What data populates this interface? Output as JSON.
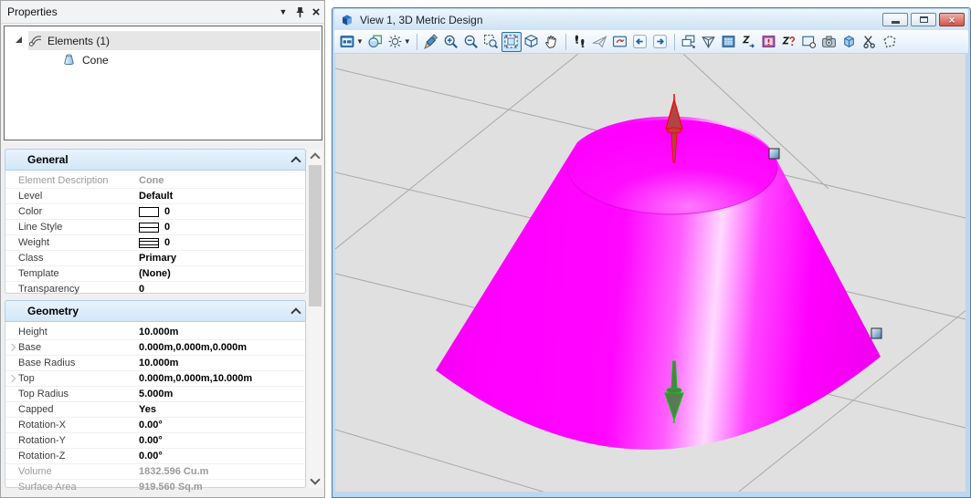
{
  "properties_panel": {
    "title": "Properties",
    "titlebar_icons": [
      "panel-menu-arrow-icon",
      "pin-icon",
      "close-icon"
    ],
    "tree": {
      "root_label": "Elements (1)",
      "items": [
        {
          "label": "Cone",
          "icon": "cone-icon"
        }
      ]
    },
    "sections": [
      {
        "title": "General",
        "rows": [
          {
            "label": "Element Description",
            "value": "Cone",
            "readonly": true
          },
          {
            "label": "Level",
            "value": "Default"
          },
          {
            "label": "Color",
            "value": "0",
            "swatch": "color"
          },
          {
            "label": "Line Style",
            "value": "0",
            "swatch": "linestyle"
          },
          {
            "label": "Weight",
            "value": "0",
            "swatch": "weight"
          },
          {
            "label": "Class",
            "value": "Primary"
          },
          {
            "label": "Template",
            "value": "(None)"
          },
          {
            "label": "Transparency",
            "value": "0"
          }
        ]
      },
      {
        "title": "Geometry",
        "rows": [
          {
            "label": "Height",
            "value": "10.000m"
          },
          {
            "label": "Base",
            "value": "0.000m,0.000m,0.000m",
            "expandable": true
          },
          {
            "label": "Base Radius",
            "value": "10.000m"
          },
          {
            "label": "Top",
            "value": "0.000m,0.000m,10.000m",
            "expandable": true
          },
          {
            "label": "Top Radius",
            "value": "5.000m"
          },
          {
            "label": "Capped",
            "value": "Yes"
          },
          {
            "label": "Rotation-X",
            "value": "0.00°"
          },
          {
            "label": "Rotation-Y",
            "value": "0.00°"
          },
          {
            "label": "Rotation-Z",
            "value": "0.00°"
          },
          {
            "label": "Volume",
            "value": "1832.596 Cu.m",
            "readonly": true
          },
          {
            "label": "Surface Area",
            "value": "919.560 Sq.m",
            "readonly": true
          }
        ]
      }
    ]
  },
  "view_window": {
    "title": "View 1, 3D Metric Design",
    "titlebar_buttons": [
      {
        "name": "minimize-button",
        "label": "Minimize"
      },
      {
        "name": "maximize-button",
        "label": "Maximize"
      },
      {
        "name": "close-button",
        "label": "Close"
      }
    ],
    "toolbar": {
      "items": [
        {
          "name": "view-attributes",
          "icon": "view-attributes",
          "dropdown": true
        },
        {
          "name": "display-style",
          "icon": "display-style"
        },
        {
          "name": "adjust-view-brightness",
          "icon": "brightness",
          "dropdown": true
        },
        {
          "sep": true
        },
        {
          "name": "update-view",
          "icon": "update-view"
        },
        {
          "name": "zoom-in",
          "icon": "zoom-in"
        },
        {
          "name": "zoom-out",
          "icon": "zoom-out"
        },
        {
          "name": "window-area",
          "icon": "window-area"
        },
        {
          "name": "fit-view",
          "icon": "fit-view",
          "active": true
        },
        {
          "name": "rotate-view",
          "icon": "rotate-view"
        },
        {
          "name": "pan-view",
          "icon": "pan"
        },
        {
          "sep": true
        },
        {
          "name": "walk",
          "icon": "walk"
        },
        {
          "name": "fly",
          "icon": "fly"
        },
        {
          "name": "navigate-view",
          "icon": "navigate"
        },
        {
          "name": "view-previous",
          "icon": "view-previous"
        },
        {
          "name": "view-next",
          "icon": "view-next"
        },
        {
          "sep": true
        },
        {
          "name": "copy-view",
          "icon": "copy-view"
        },
        {
          "name": "change-view-perspective",
          "icon": "perspective"
        },
        {
          "name": "set-active-depth",
          "icon": "active-depth"
        },
        {
          "name": "set-display-depth",
          "icon": "set-depth"
        },
        {
          "name": "update-depth",
          "icon": "update-depth"
        },
        {
          "name": "show-display-depth",
          "icon": "show-depth"
        },
        {
          "name": "clip-volume",
          "icon": "clip-volume"
        },
        {
          "name": "camera-settings",
          "icon": "camera"
        },
        {
          "name": "clip-front",
          "icon": "clip-front"
        },
        {
          "name": "clip-mask",
          "icon": "clip-mask"
        },
        {
          "name": "fence-clip",
          "icon": "fence-clip"
        }
      ]
    },
    "viewport": {
      "element": "Cone",
      "surface_color": "#ff00ff",
      "background_color": "#e0e0e0",
      "grid_color": "#a9a9a9",
      "manipulators": [
        "red-up-arrow",
        "green-down-arrow"
      ],
      "selection_handles": 2
    }
  },
  "colors": {
    "accent_blue": "#2f6aa0",
    "magenta": "#ff00ff",
    "window_frame": "#bdd8ee",
    "panel_background": "#f0f0f0"
  }
}
